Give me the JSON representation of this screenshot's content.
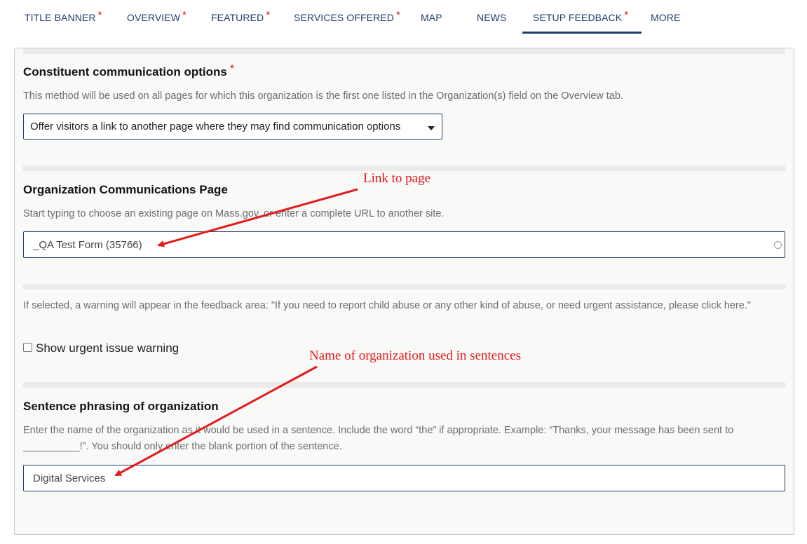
{
  "tabs": [
    {
      "label": "TITLE BANNER",
      "required": "*"
    },
    {
      "label": "OVERVIEW",
      "required": "*"
    },
    {
      "label": "FEATURED",
      "required": "*"
    },
    {
      "label": "SERVICES OFFERED",
      "required": "*"
    },
    {
      "label": "MAP",
      "required": ""
    },
    {
      "label": "NEWS",
      "required": ""
    },
    {
      "label": "SETUP FEEDBACK",
      "required": "*",
      "active": true
    },
    {
      "label": "MORE",
      "required": ""
    }
  ],
  "communication_options": {
    "label": "Constituent communication options",
    "required": "*",
    "description": "This method will be used on all pages for which this organization is the first one listed in the Organization(s) field on the Overview tab.",
    "selected": "Offer visitors a link to another page where they may find communication options"
  },
  "communications_page": {
    "label": "Organization Communications Page",
    "description": "Start typing to choose an existing page on Mass.gov, or enter a complete URL to another site.",
    "value": "_QA Test Form (35766)"
  },
  "urgent_warning": {
    "description": "If selected, a warning will appear in the feedback area: \"If you need to report child abuse or any other kind of abuse, or need urgent assistance, please click here.\"",
    "checkbox_label": "Show urgent issue warning",
    "checked": false
  },
  "sentence_phrasing": {
    "label": "Sentence phrasing of organization",
    "description": "Enter the name of the organization as it would be used in a sentence. Include the word “the” if appropriate. Example: “Thanks, your message has been sent to __________!”. You should only enter the blank portion of the sentence.",
    "value": "Digital Services"
  },
  "annotations": {
    "link_to_page": "Link to page",
    "org_name": "Name of organization used in sentences"
  },
  "colors": {
    "accent": "#1f3e6b",
    "required": "#d1151a",
    "annotation": "#e31b1b"
  }
}
